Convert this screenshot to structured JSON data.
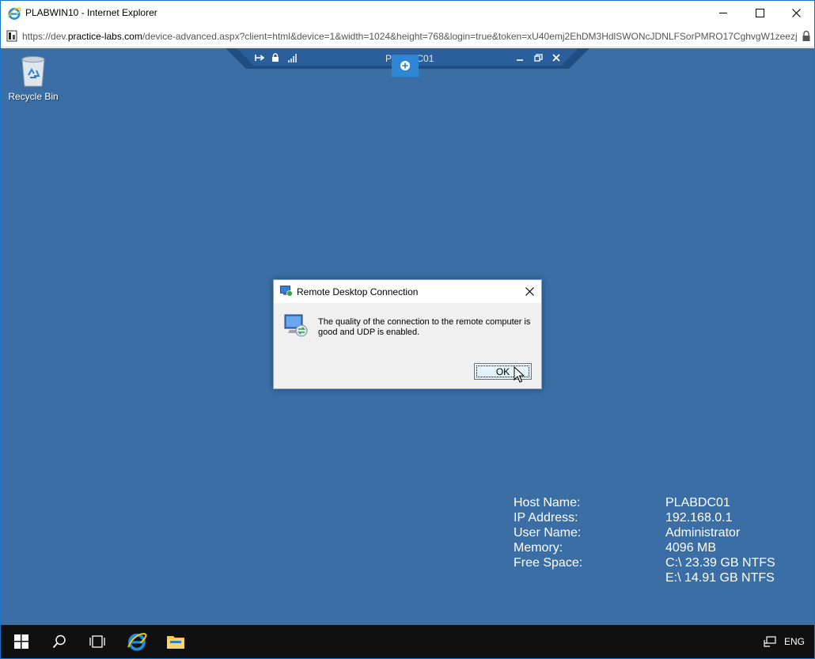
{
  "window": {
    "title": "PLABWIN10 - Internet Explorer",
    "minimize_icon": "minimize-icon",
    "maximize_icon": "maximize-icon",
    "close_icon": "close-icon"
  },
  "address_bar": {
    "url_prefix": "https://dev.",
    "url_host": "practice-labs.com",
    "url_rest": "/device-advanced.aspx?client=html&device=1&width=1024&height=768&login=true&token=xU40emj2EhDM3HdlSWONcJDNLFSorPMRO17CghvgW1zeezj"
  },
  "desktop": {
    "recycle_bin_label": "Recycle Bin",
    "background_color": "#3a6ea5"
  },
  "connection_bar": {
    "title": "PLABDC01"
  },
  "dialog": {
    "title": "Remote Desktop Connection",
    "message": "The quality of the connection to the remote computer is good and UDP is enabled.",
    "ok_label": "OK"
  },
  "system_info": {
    "rows": [
      {
        "label": "Host Name:",
        "value": "PLABDC01"
      },
      {
        "label": "IP Address:",
        "value": "192.168.0.1"
      },
      {
        "label": "User Name:",
        "value": "Administrator"
      },
      {
        "label": "Memory:",
        "value": "4096 MB"
      },
      {
        "label": "Free Space:",
        "value": "C:\\ 23.39 GB NTFS"
      },
      {
        "label": "",
        "value": "E:\\ 14.91 GB NTFS"
      }
    ]
  },
  "taskbar": {
    "language": "ENG"
  }
}
